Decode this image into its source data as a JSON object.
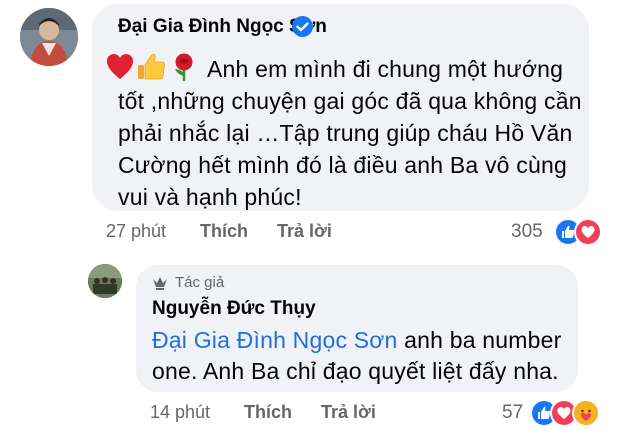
{
  "comment": {
    "author": "Đại Gia Đình Ngọc Sơn",
    "emojis": [
      "heart",
      "thumbs-up",
      "rose"
    ],
    "text_first_line": "Anh em mình đi chung một hướng",
    "text_rest": "tốt ,những chuyện gai góc đã qua không cần phải nhắc lại …Tập trung  giúp cháu Hồ Văn Cường hết mình đó là điều anh Ba vô cùng vui và hạnh phúc!",
    "time": "27 phút",
    "like_label": "Thích",
    "reply_label": "Trả lời",
    "reaction_count": "305",
    "reactions": [
      "like",
      "love"
    ]
  },
  "reply": {
    "author_badge": "Tác giả",
    "author": "Nguyễn Đức Thụy",
    "mention": "Đại Gia Đình Ngọc Sơn",
    "text_after_mention": " anh ba number",
    "text_line2": "one. Anh Ba chỉ đạo quyết liệt đấy nha.",
    "time": "14 phút",
    "like_label": "Thích",
    "reply_label": "Trả lời",
    "reaction_count": "57",
    "reactions": [
      "like",
      "love",
      "care"
    ]
  },
  "colors": {
    "bubble": "#f0f2f5",
    "meta_text": "#65676b",
    "mention": "#216fdb",
    "verified": "#1877f2",
    "like": "#1877f2",
    "love": "#f33e58",
    "care": "#f7b125"
  }
}
